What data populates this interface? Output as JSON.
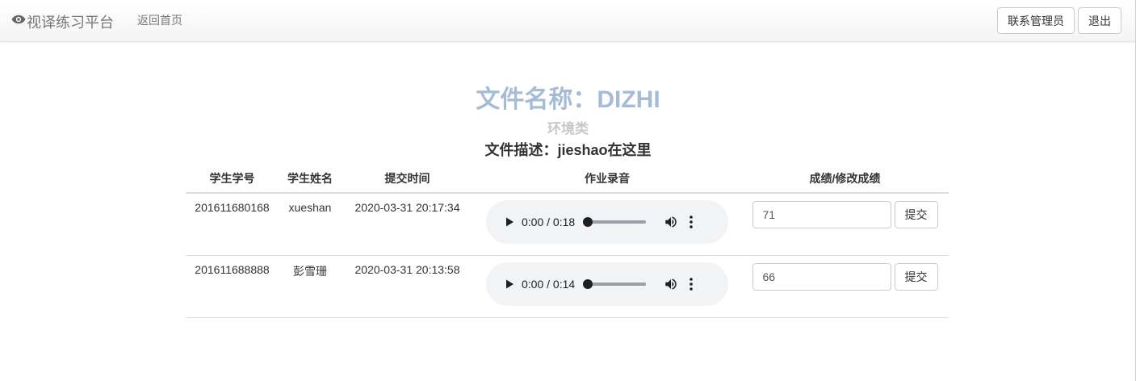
{
  "navbar": {
    "brand": "视译练习平台",
    "home_link": "返回首页",
    "contact_button": "联系管理员",
    "logout_button": "退出"
  },
  "file": {
    "name": "文件名称：DIZHI",
    "category": "环境类",
    "description": "文件描述：jieshao在这里"
  },
  "table": {
    "headers": [
      "学生学号",
      "学生姓名",
      "提交时间",
      "作业录音",
      "成绩/修改成绩"
    ],
    "rows": [
      {
        "student_id": "201611680168",
        "student_name": "xueshan",
        "submit_time": "2020-03-31 20:17:34",
        "audio_time": "0:00 / 0:18",
        "score": "71",
        "submit_label": "提交"
      },
      {
        "student_id": "201611688888",
        "student_name": "彭雪珊",
        "submit_time": "2020-03-31 20:13:58",
        "audio_time": "0:00 / 0:14",
        "score": "66",
        "submit_label": "提交"
      }
    ]
  },
  "colors": {
    "file_name": "#a6bcd6",
    "category": "#c8c8c8",
    "player_bg": "#f1f3f4"
  }
}
